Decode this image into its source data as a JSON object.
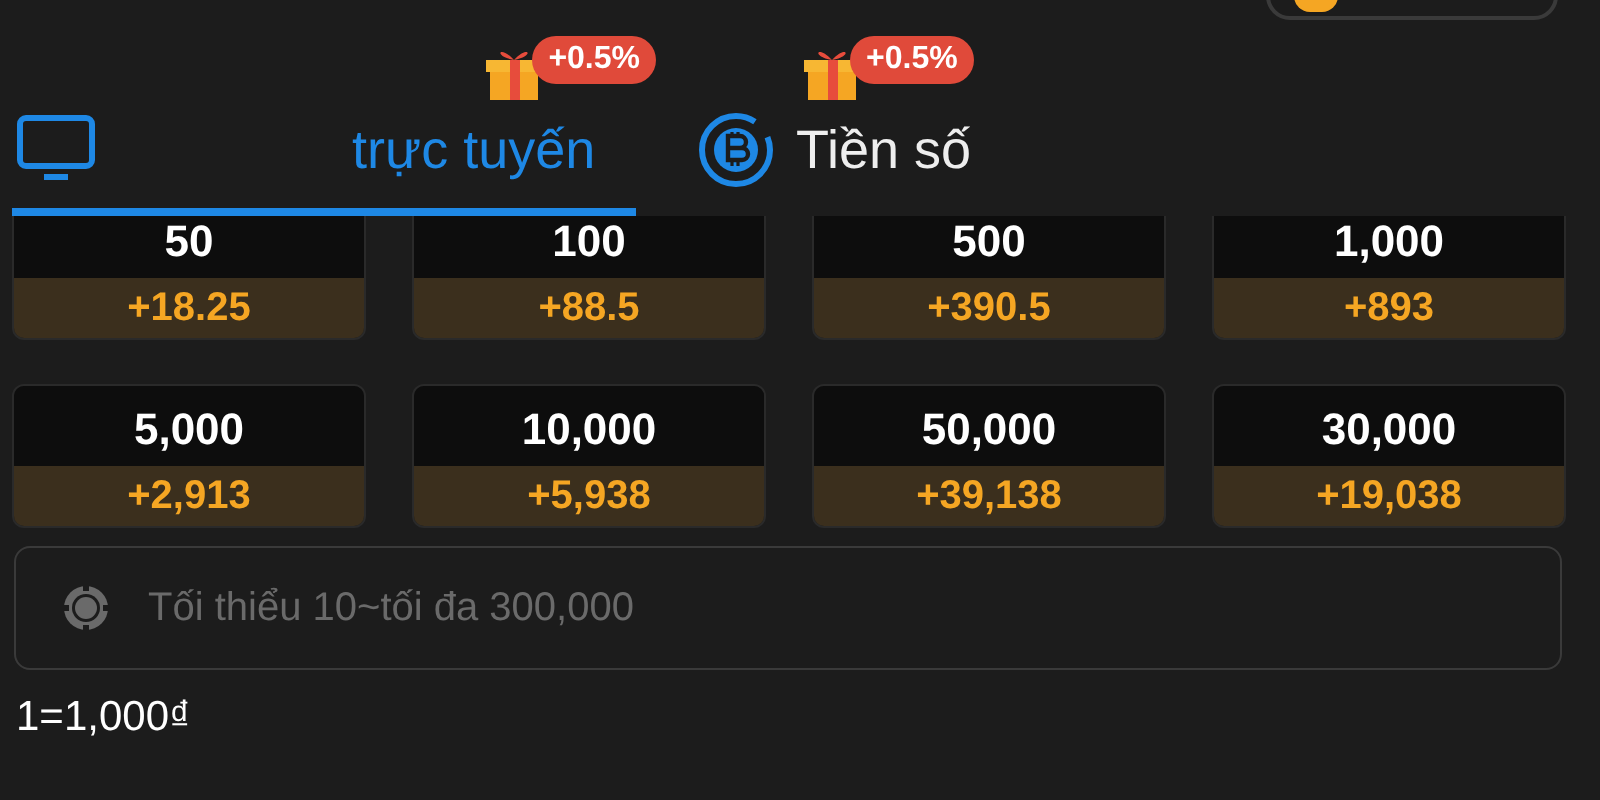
{
  "tabs": [
    {
      "kind": "device",
      "label": "trực tuyến",
      "bonus": "+0.5%",
      "selected": true
    },
    {
      "kind": "crypto",
      "label": "Tiền số",
      "bonus": "+0.5%",
      "selected": false
    }
  ],
  "amounts": [
    {
      "amount": "50",
      "bonus": "+18.25"
    },
    {
      "amount": "100",
      "bonus": "+88.5"
    },
    {
      "amount": "500",
      "bonus": "+390.5"
    },
    {
      "amount": "1,000",
      "bonus": "+893"
    },
    {
      "amount": "5,000",
      "bonus": "+2,913"
    },
    {
      "amount": "10,000",
      "bonus": "+5,938"
    },
    {
      "amount": "50,000",
      "bonus": "+39,138"
    },
    {
      "amount": "30,000",
      "bonus": "+19,038"
    }
  ],
  "amount_field": {
    "placeholder": "Tối thiểu 10~tối đa 300,000"
  },
  "rate": "1=1,000₫"
}
